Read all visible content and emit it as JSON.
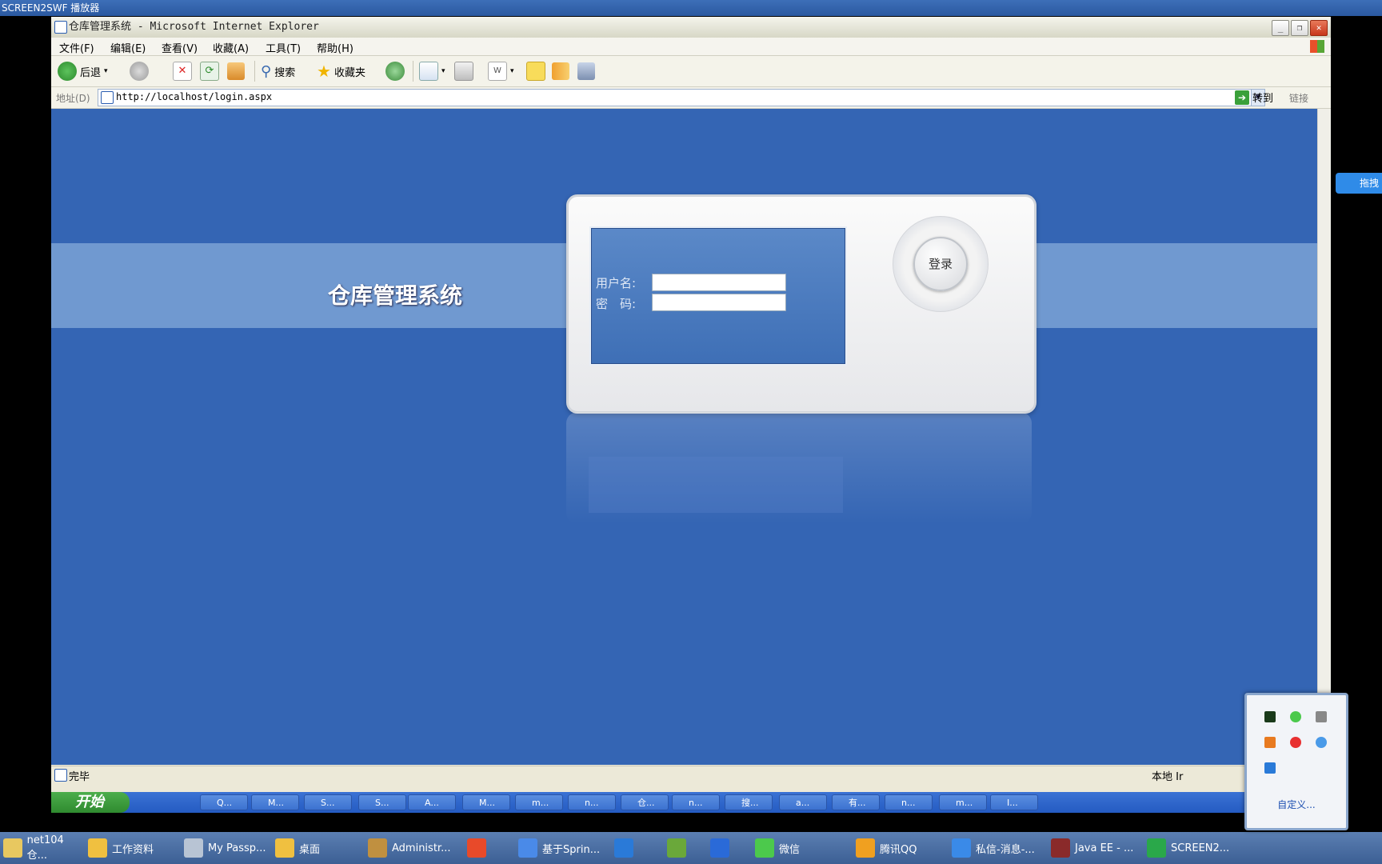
{
  "player": {
    "title": "SCREEN2SWF 播放器"
  },
  "ie": {
    "title": "仓库管理系统 - Microsoft Internet Explorer",
    "menu": [
      "文件(F)",
      "编辑(E)",
      "查看(V)",
      "收藏(A)",
      "工具(T)",
      "帮助(H)"
    ],
    "toolbar": {
      "back": "后退",
      "search": "搜索",
      "favorites": "收藏夹"
    },
    "address": {
      "label": "地址(D)",
      "url": "http://localhost/login.aspx",
      "go": "转到",
      "links": "链接"
    },
    "status": {
      "text": "完毕",
      "zone": "本地 Ir"
    }
  },
  "page": {
    "site_title": "仓库管理系统",
    "username_label": "用户名:",
    "password_label": "密　码:",
    "login_button": "登录"
  },
  "inner_taskbar": {
    "start": "开始",
    "tasks": [
      "Q...",
      "M...",
      "S...",
      "S...",
      "A...",
      "M...",
      "m...",
      "n...",
      "仓...",
      "n...",
      "搜...",
      "a...",
      "有...",
      "n...",
      "m...",
      "I..."
    ]
  },
  "outer_taskbar": {
    "tasks": [
      "net104仓...",
      "工作资料",
      "My Passp...",
      "桌面",
      "Administr...",
      "",
      "基于Sprin...",
      "",
      "",
      "",
      "微信",
      "腾讯QQ",
      "私信-消息-...",
      "Java EE - ...",
      "SCREEN2..."
    ]
  },
  "tray": {
    "customize": "自定义..."
  },
  "side_chip": {
    "label": "拖拽"
  },
  "colors": {
    "page_bg": "#3465b4",
    "band": "#7099d0",
    "login_panel": "#4a7bc0"
  }
}
